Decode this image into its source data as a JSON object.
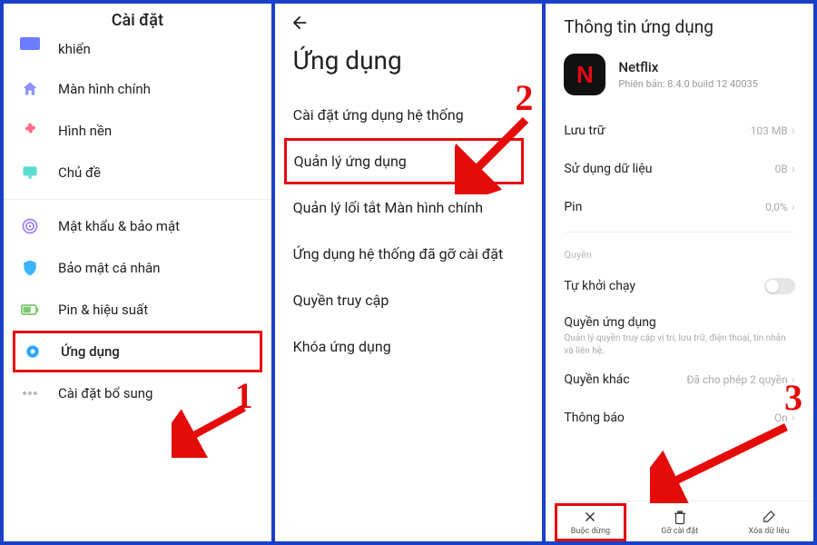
{
  "annotations": {
    "step1": "1",
    "step2": "2",
    "step3": "3"
  },
  "panel1": {
    "title": "Cài đặt",
    "items": {
      "i0": "khiển",
      "i1": "Màn hình chính",
      "i2": "Hình nền",
      "i3": "Chủ đề",
      "i4": "Mật khẩu & bảo mật",
      "i5": "Bảo mật cá nhân",
      "i6": "Pin & hiệu suất",
      "i7": "Ứng dụng",
      "i8": "Cài đặt bổ sung"
    }
  },
  "panel2": {
    "title": "Ứng dụng",
    "items": {
      "i0": "Cài đặt ứng dụng hệ thống",
      "i1": "Quản lý ứng dụng",
      "i2": "Quản lý lối tắt Màn hình chính",
      "i3": "Ứng dụng hệ thống đã gỡ cài đặt",
      "i4": "Quyền truy cập",
      "i5": "Khóa ứng dụng"
    }
  },
  "panel3": {
    "title": "Thông tin ứng dụng",
    "app": {
      "name": "Netflix",
      "versionLabel": "Phiên bản: 8.4.0 build 12 40035",
      "iconLetter": "N"
    },
    "rows": {
      "storage": {
        "label": "Lưu trữ",
        "value": "103 MB"
      },
      "datausage": {
        "label": "Sử dụng dữ liệu",
        "value": "0B"
      },
      "battery": {
        "label": "Pin",
        "value": "0,0%"
      },
      "permsSection": "Quyền",
      "autostart": {
        "label": "Tự khởi chạy"
      },
      "appperm": {
        "label": "Quyền ứng dụng",
        "desc": "Quản lý quyền truy cập vị trí, lưu trữ, điện thoại, tin nhắn và liên hệ."
      },
      "otherperm": {
        "label": "Quyền khác",
        "value": "Đã cho phép 2 quyền"
      },
      "notif": {
        "label": "Thông báo",
        "value": "On"
      }
    },
    "actions": {
      "forcestop": "Buộc dừng",
      "uninstall": "Gỡ cài đặt",
      "cleardata": "Xóa dữ liệu"
    }
  }
}
